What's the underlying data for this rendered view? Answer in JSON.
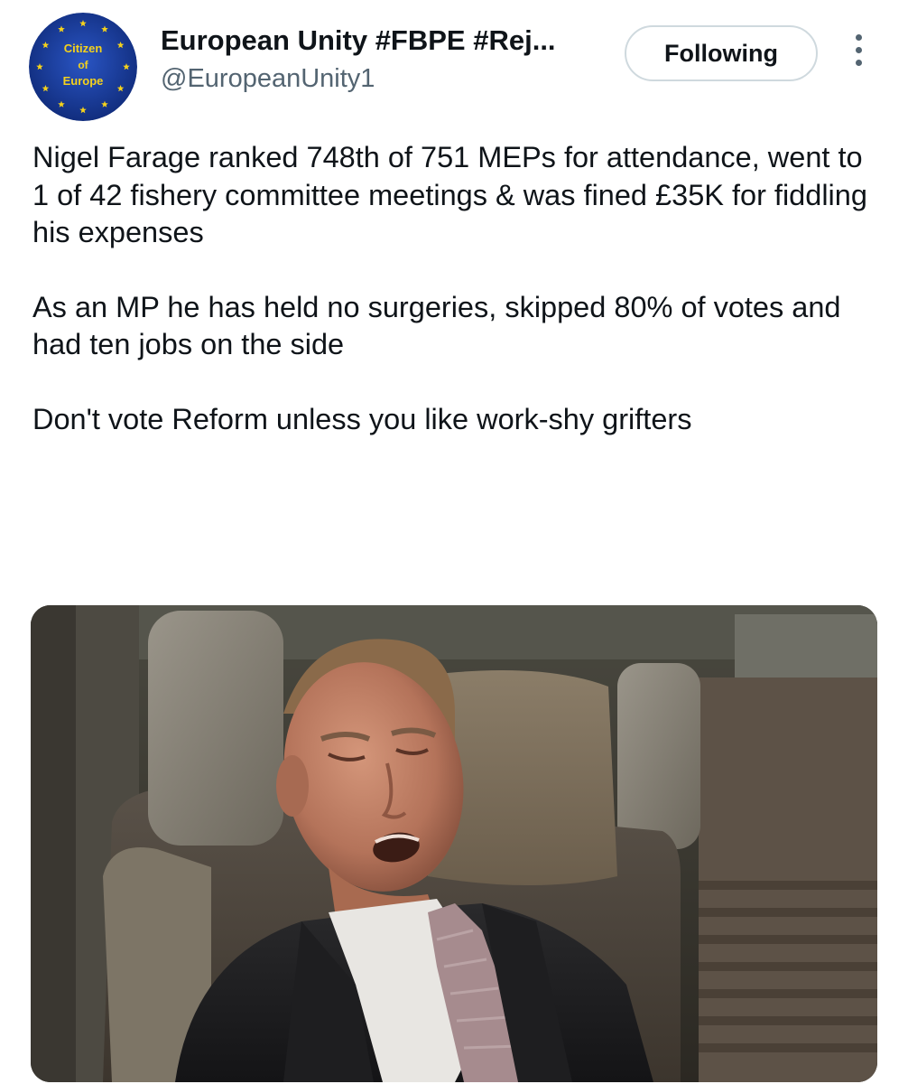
{
  "account": {
    "display_name": "European Unity #FBPE #Rej...",
    "handle": "@EuropeanUnity1",
    "avatar_text": [
      "Citizen",
      "of",
      "Europe"
    ],
    "avatar_color": "#1b3f9e",
    "star_color": "#f5d21c"
  },
  "follow_button": {
    "label": "Following"
  },
  "more_icon": "more-vertical-icon",
  "tweet": {
    "paragraphs": [
      "Nigel Farage ranked 748th of 751 MEPs for attendance, went to 1 of 42 fishery committee meetings & was fined £35K for fiddling his expenses",
      "As an MP he has held no surgeries, skipped 80% of votes and had ten jobs on the side",
      "Don't vote Reform unless you like work-shy grifters"
    ]
  }
}
